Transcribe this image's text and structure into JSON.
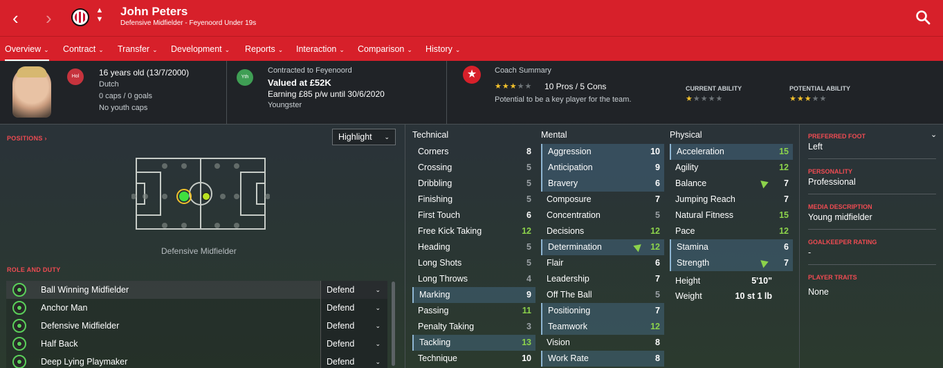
{
  "header": {
    "player_name": "John Peters",
    "subtitle": "Defensive Midfielder - Feyenoord Under 19s",
    "back_icon": "‹",
    "forward_icon": "›",
    "updown_icon": "⌃⌄"
  },
  "menu": {
    "items": [
      {
        "label": "Overview"
      },
      {
        "label": "Contract"
      },
      {
        "label": "Transfer"
      },
      {
        "label": "Development"
      },
      {
        "label": "Reports"
      },
      {
        "label": "Interaction"
      },
      {
        "label": "Comparison"
      },
      {
        "label": "History"
      }
    ]
  },
  "info": {
    "nation_badge": "Hol",
    "age": "16 years old (13/7/2000)",
    "nationality": "Dutch",
    "caps": "0 caps / 0 goals",
    "youth_caps": "No youth caps",
    "youth_badge": "Yth",
    "contract_label": "Contracted to Feyenoord",
    "value": "Valued at £52K",
    "earning": "Earning £85 p/w until 30/6/2020",
    "status": "Youngster",
    "coach_label": "Coach Summary",
    "coach_stars": 3,
    "pros_cons": "10 Pros / 5 Cons",
    "potential_text": "Potential to be a key player for the team.",
    "current_ability_label": "CURRENT ABILITY",
    "current_ability_stars": 1,
    "potential_ability_label": "POTENTIAL ABILITY",
    "potential_ability_stars": 3
  },
  "positions": {
    "label": "POSITIONS",
    "highlight_select": "Highlight",
    "caption": "Defensive Midfielder"
  },
  "roles": {
    "label": "ROLE AND DUTY",
    "items": [
      {
        "name": "Ball Winning Midfielder",
        "duty": "Defend"
      },
      {
        "name": "Anchor Man",
        "duty": "Defend"
      },
      {
        "name": "Defensive Midfielder",
        "duty": "Defend"
      },
      {
        "name": "Half Back",
        "duty": "Defend"
      },
      {
        "name": "Deep Lying Playmaker",
        "duty": "Defend"
      }
    ]
  },
  "technical": {
    "title": "Technical",
    "attrs": [
      {
        "name": "Corners",
        "value": "8"
      },
      {
        "name": "Crossing",
        "value": "5"
      },
      {
        "name": "Dribbling",
        "value": "5"
      },
      {
        "name": "Finishing",
        "value": "5"
      },
      {
        "name": "First Touch",
        "value": "6"
      },
      {
        "name": "Free Kick Taking",
        "value": "12"
      },
      {
        "name": "Heading",
        "value": "5"
      },
      {
        "name": "Long Shots",
        "value": "5"
      },
      {
        "name": "Long Throws",
        "value": "4"
      },
      {
        "name": "Marking",
        "value": "9"
      },
      {
        "name": "Passing",
        "value": "11"
      },
      {
        "name": "Penalty Taking",
        "value": "3"
      },
      {
        "name": "Tackling",
        "value": "13"
      },
      {
        "name": "Technique",
        "value": "10"
      }
    ]
  },
  "mental": {
    "title": "Mental",
    "attrs": [
      {
        "name": "Aggression",
        "value": "10"
      },
      {
        "name": "Anticipation",
        "value": "9"
      },
      {
        "name": "Bravery",
        "value": "6"
      },
      {
        "name": "Composure",
        "value": "7"
      },
      {
        "name": "Concentration",
        "value": "5"
      },
      {
        "name": "Decisions",
        "value": "12"
      },
      {
        "name": "Determination",
        "value": "12"
      },
      {
        "name": "Flair",
        "value": "6"
      },
      {
        "name": "Leadership",
        "value": "7"
      },
      {
        "name": "Off The Ball",
        "value": "5"
      },
      {
        "name": "Positioning",
        "value": "7"
      },
      {
        "name": "Teamwork",
        "value": "12"
      },
      {
        "name": "Vision",
        "value": "8"
      },
      {
        "name": "Work Rate",
        "value": "8"
      }
    ]
  },
  "physical": {
    "title": "Physical",
    "attrs": [
      {
        "name": "Acceleration",
        "value": "15"
      },
      {
        "name": "Agility",
        "value": "12"
      },
      {
        "name": "Balance",
        "value": "7"
      },
      {
        "name": "Jumping Reach",
        "value": "7"
      },
      {
        "name": "Natural Fitness",
        "value": "15"
      },
      {
        "name": "Pace",
        "value": "12"
      },
      {
        "name": "Stamina",
        "value": "6"
      },
      {
        "name": "Strength",
        "value": "7"
      }
    ],
    "height_label": "Height",
    "height": "5'10\"",
    "weight_label": "Weight",
    "weight": "10 st 1 lb"
  },
  "side": {
    "preferred_foot_label": "PREFERRED FOOT",
    "preferred_foot": "Left",
    "personality_label": "PERSONALITY",
    "personality": "Professional",
    "media_label": "MEDIA DESCRIPTION",
    "media": "Young midfielder",
    "gk_label": "GOALKEEPER RATING",
    "gk": "-",
    "traits_label": "PLAYER TRAITS",
    "traits": "None"
  },
  "colors": {
    "brand_red": "#d7202a",
    "highlight_green": "#8cd24b",
    "star_gold": "#f3c12c"
  }
}
